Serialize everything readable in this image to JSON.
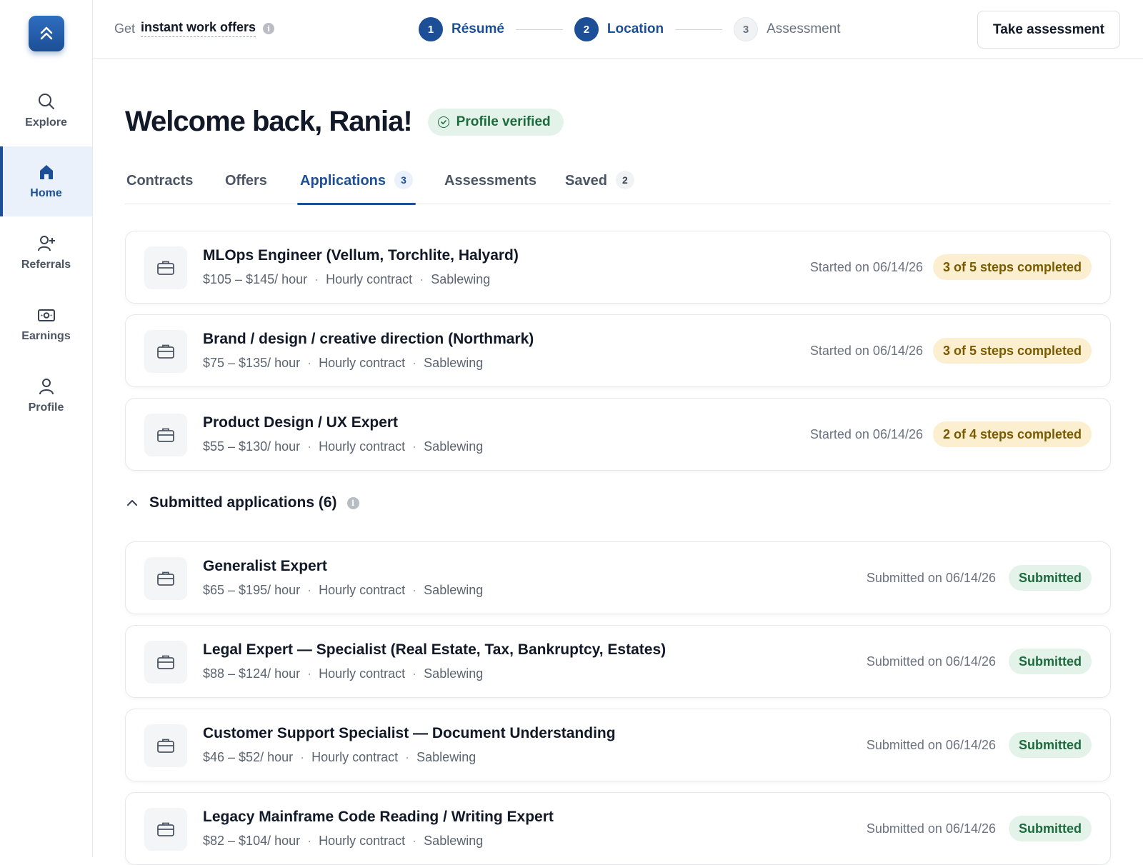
{
  "sidebar": {
    "items": [
      {
        "label": "Explore",
        "icon": "search-icon"
      },
      {
        "label": "Home",
        "icon": "home-icon"
      },
      {
        "label": "Referrals",
        "icon": "person-add-icon"
      },
      {
        "label": "Earnings",
        "icon": "banknote-icon"
      },
      {
        "label": "Profile",
        "icon": "person-icon"
      }
    ],
    "active": "Home"
  },
  "topbar": {
    "promo_prefix": "Get",
    "promo_link": "instant work offers",
    "info_glyph": "i",
    "steps": [
      {
        "number": "1",
        "label": "Résumé",
        "state": "done"
      },
      {
        "number": "2",
        "label": "Location",
        "state": "done"
      },
      {
        "number": "3",
        "label": "Assessment",
        "state": "todo"
      }
    ],
    "take_assessment_label": "Take assessment"
  },
  "main": {
    "welcome": "Welcome back, Rania!",
    "verified_badge": "Profile verified",
    "tabs": [
      {
        "label": "Contracts"
      },
      {
        "label": "Offers"
      },
      {
        "label": "Applications",
        "count": "3",
        "active": true
      },
      {
        "label": "Assessments"
      },
      {
        "label": "Saved",
        "count": "2"
      }
    ],
    "in_progress": [
      {
        "title": "MLOps Engineer (Vellum, Torchlite, Halyard)",
        "rate": "$105 – $145/ hour",
        "type": "Hourly contract",
        "company": "Sablewing",
        "date": "Started on 06/14/26",
        "status": "3 of 5 steps completed"
      },
      {
        "title": "Brand / design / creative direction (Northmark)",
        "rate": "$75 – $135/ hour",
        "type": "Hourly contract",
        "company": "Sablewing",
        "date": "Started on 06/14/26",
        "status": "3 of 5 steps completed"
      },
      {
        "title": "Product Design / UX Expert",
        "rate": "$55 – $130/ hour",
        "type": "Hourly contract",
        "company": "Sablewing",
        "date": "Started on 06/14/26",
        "status": "2 of 4 steps completed"
      }
    ],
    "submitted_header": "Submitted applications (6)",
    "submitted": [
      {
        "title": "Generalist Expert",
        "rate": "$65 – $195/ hour",
        "type": "Hourly contract",
        "company": "Sablewing",
        "date": "Submitted on 06/14/26",
        "status": "Submitted"
      },
      {
        "title": "Legal Expert — Specialist (Real Estate, Tax, Bankruptcy, Estates)",
        "rate": "$88 – $124/ hour",
        "type": "Hourly contract",
        "company": "Sablewing",
        "date": "Submitted on 06/14/26",
        "status": "Submitted"
      },
      {
        "title": "Customer Support Specialist — Document Understanding",
        "rate": "$46 – $52/ hour",
        "type": "Hourly contract",
        "company": "Sablewing",
        "date": "Submitted on 06/14/26",
        "status": "Submitted"
      },
      {
        "title": "Legacy Mainframe Code Reading / Writing Expert",
        "rate": "$82 – $104/ hour",
        "type": "Hourly contract",
        "company": "Sablewing",
        "date": "Submitted on 06/14/26",
        "status": "Submitted"
      }
    ],
    "separator_glyph": "·"
  },
  "colors": {
    "brand": "#1c4f95",
    "progress_bg": "#fbefcf",
    "progress_text": "#7a5a00",
    "success_bg": "#e4f3ea",
    "success_text": "#1c6b3d"
  }
}
